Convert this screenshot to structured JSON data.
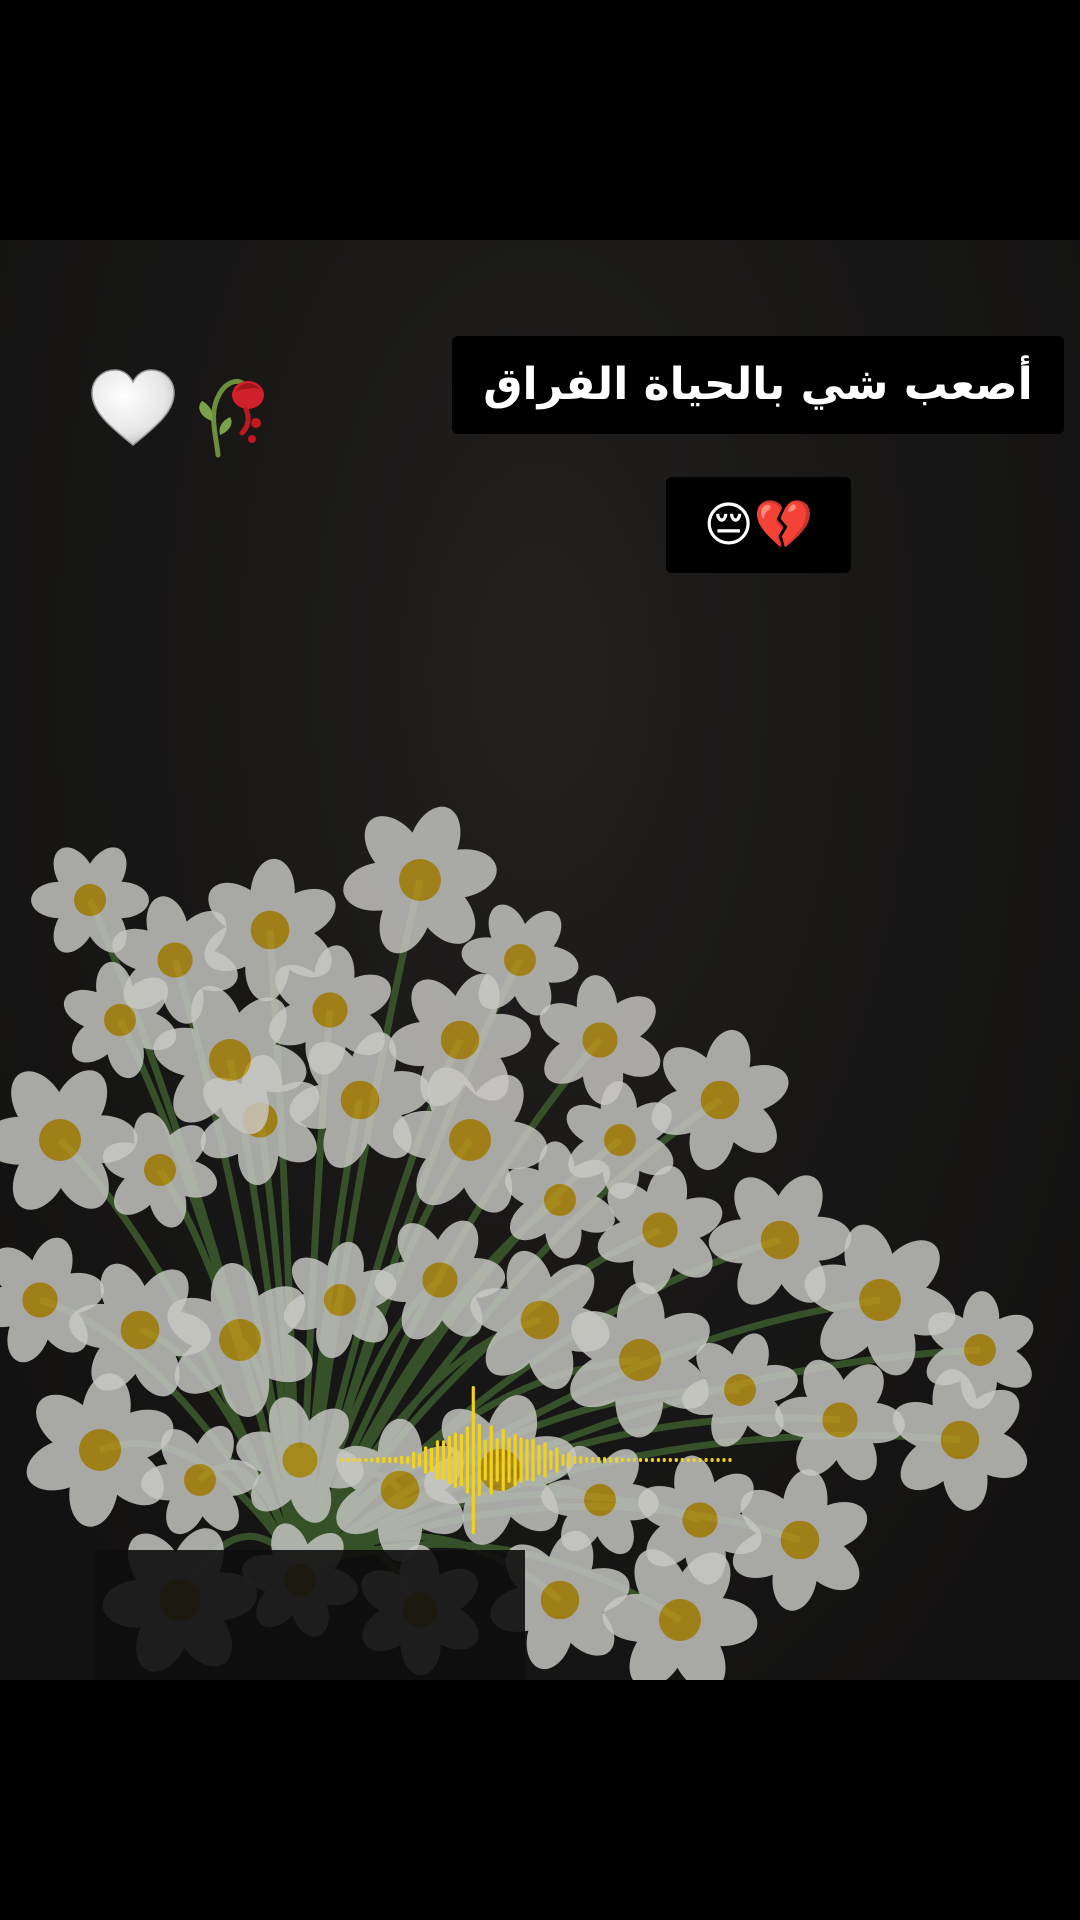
{
  "caption": {
    "main_text": "أصعب شي بالحياة الفراق",
    "emoji_text": "😔💔"
  },
  "decorations": {
    "left_icons": [
      "white-heart-icon",
      "wilted-rose-icon"
    ]
  },
  "audio_visualizer": {
    "color": "#f2d21b",
    "icon": "audio-waveform-icon"
  },
  "colors": {
    "background": "#000000",
    "caption_background": "#000000",
    "caption_text": "#ffffff",
    "petal": "#f5f5f0",
    "flower_center": "#e8b820",
    "stem": "#4f7a3a"
  }
}
